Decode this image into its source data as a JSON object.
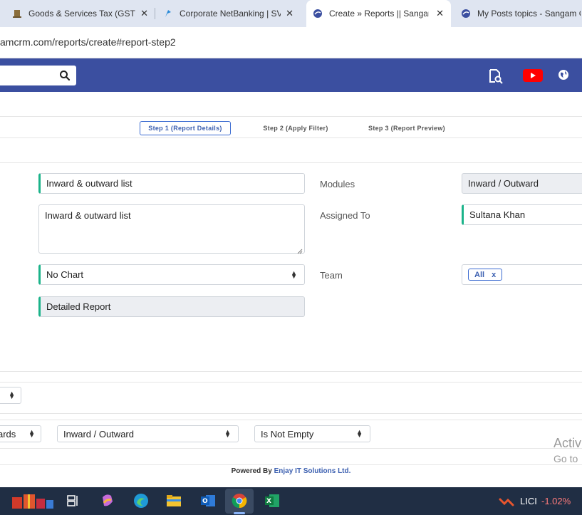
{
  "browser": {
    "tabs": [
      {
        "title": "Goods & Services Tax (GST) |",
        "active": false
      },
      {
        "title": "Corporate NetBanking | SVC",
        "active": false
      },
      {
        "title": "Create » Reports || Sangam C",
        "active": true
      },
      {
        "title": "My Posts topics - Sangam C",
        "active": false
      }
    ],
    "url": "amcrm.com/reports/create#report-step2"
  },
  "header": {
    "search_placeholder": "",
    "icons": [
      "document-search-icon",
      "youtube-icon",
      "globe-icon"
    ]
  },
  "steps": [
    {
      "label": "Step 1 (Report Details)",
      "active": true
    },
    {
      "label": "Step 2 (Apply Filter)",
      "active": false
    },
    {
      "label": "Step 3 (Report Preview)",
      "active": false
    }
  ],
  "form": {
    "report_name": "Inward & outward list",
    "description": "Inward & outward list",
    "chart_type": "No Chart",
    "report_type": "Detailed Report",
    "modules_label": "Modules",
    "modules_value": "Inward / Outward",
    "assigned_to_label": "Assigned To",
    "assigned_to_value": "Sultana Khan",
    "team_label": "Team",
    "team_chip": "All",
    "team_chip_remove": "x"
  },
  "filter": {
    "field_partial": "ards",
    "module": "Inward / Outward",
    "condition": "Is Not Empty"
  },
  "watermark": {
    "line1": "Activ",
    "line2": "Go to"
  },
  "footer": {
    "prefix": "Powered By",
    "brand": "Enjay IT Solutions Ltd."
  },
  "taskbar": {
    "ticker_name": "LICI",
    "ticker_change": "-1.02%"
  },
  "colors": {
    "header_bg": "#3b4fa0",
    "accent_green": "#1bb38a",
    "accent_blue": "#3b6bd1",
    "taskbar_bg": "#202e44"
  }
}
